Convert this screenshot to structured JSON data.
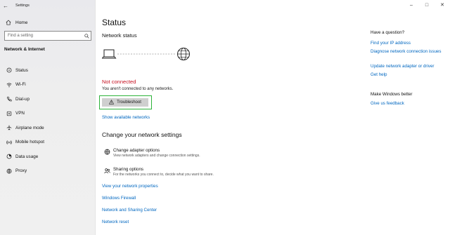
{
  "window": {
    "app_title": "Settings",
    "controls": {
      "minimize": "–",
      "maximize": "□",
      "close": "✕"
    }
  },
  "sidebar": {
    "back": "←",
    "home": "Home",
    "search_placeholder": "Find a setting",
    "section": "Network & Internet",
    "items": [
      {
        "label": "Status",
        "icon": "status-icon"
      },
      {
        "label": "Wi-Fi",
        "icon": "wifi-icon"
      },
      {
        "label": "Dial-up",
        "icon": "dialup-icon"
      },
      {
        "label": "VPN",
        "icon": "vpn-icon"
      },
      {
        "label": "Airplane mode",
        "icon": "airplane-icon"
      },
      {
        "label": "Mobile hotspot",
        "icon": "hotspot-icon"
      },
      {
        "label": "Data usage",
        "icon": "data-usage-icon"
      },
      {
        "label": "Proxy",
        "icon": "proxy-icon"
      }
    ]
  },
  "main": {
    "title": "Status",
    "network_status": "Network status",
    "not_connected": "Not connected",
    "not_connected_desc": "You aren't connected to any networks.",
    "troubleshoot": "Troubleshoot",
    "show_available": "Show available networks",
    "change_heading": "Change your network settings",
    "adapter": {
      "title": "Change adapter options",
      "desc": "View network adapters and change connection settings."
    },
    "sharing": {
      "title": "Sharing options",
      "desc": "For the networks you connect to, decide what you want to share."
    },
    "links": {
      "properties": "View your network properties",
      "firewall": "Windows Firewall",
      "center": "Network and Sharing Center",
      "reset": "Network reset"
    }
  },
  "right": {
    "question": "Have a question?",
    "find_ip": "Find your IP address",
    "diagnose": "Diagnose network connection issues",
    "update_driver": "Update network adapter or driver",
    "get_help": "Get help",
    "make_better": "Make Windows better",
    "feedback": "Give us feedback"
  },
  "colors": {
    "accent_link": "#0067c0",
    "error_red": "#c50f1f",
    "highlight_green": "#2db33a"
  }
}
